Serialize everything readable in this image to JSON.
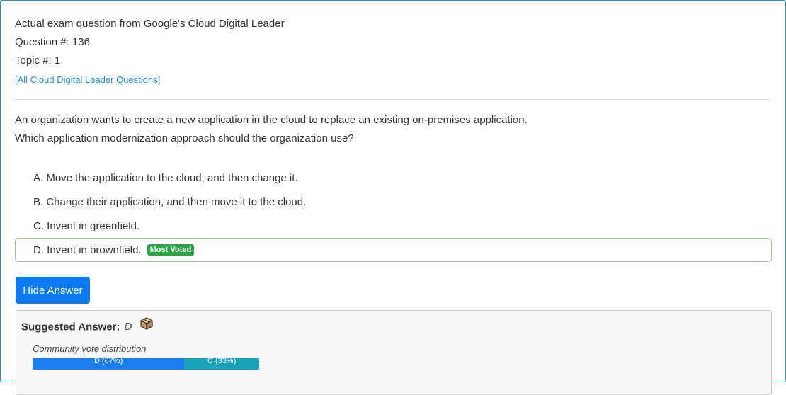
{
  "header": {
    "source_line": "Actual exam question from Google's Cloud Digital Leader",
    "question_number": "Question #: 136",
    "topic_number": "Topic #: 1",
    "all_questions_link": "[All Cloud Digital Leader Questions]"
  },
  "question": {
    "line1": "An organization wants to create a new application in the cloud to replace an existing on-premises application.",
    "line2": "Which application modernization approach should the organization use?"
  },
  "choices": [
    {
      "text": "A. Move the application to the cloud, and then change it."
    },
    {
      "text": "B. Change their application, and then move it to the cloud."
    },
    {
      "text": "C. Invent in greenfield."
    },
    {
      "text": "D. Invent in brownfield.",
      "badge": "Most Voted"
    }
  ],
  "hide_answer_button": "Hide Answer",
  "suggested_answer": {
    "label": "Suggested Answer:",
    "value": "D",
    "icon": "box-icon"
  },
  "community_vote": {
    "label": "Community vote distribution",
    "segments": [
      {
        "label": "D (67%)",
        "percent": 67,
        "color": "#1a7ef0"
      },
      {
        "label": "C (33%)",
        "percent": 33,
        "color": "#19a2b8"
      }
    ]
  }
}
